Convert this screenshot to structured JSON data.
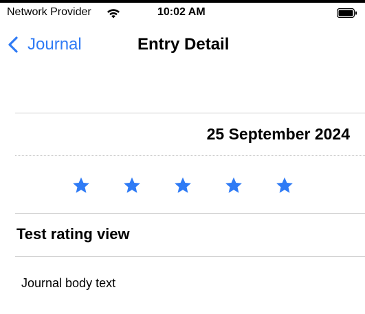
{
  "status_bar": {
    "carrier": "Network Provider",
    "time": "10:02 AM",
    "wifi_icon": "wifi-icon",
    "battery_icon": "battery-icon"
  },
  "nav": {
    "back_label": "Journal",
    "back_icon": "chevron-left-icon",
    "title": "Entry Detail"
  },
  "entry": {
    "date": "25 September 2024",
    "rating": 5,
    "rating_max": 5,
    "title": "Test rating view",
    "body": "Journal body text"
  },
  "colors": {
    "accent": "#2f7bf5",
    "star": "#2f7bf5",
    "separator": "#cfcfcf",
    "text": "#000000",
    "background": "#ffffff"
  }
}
